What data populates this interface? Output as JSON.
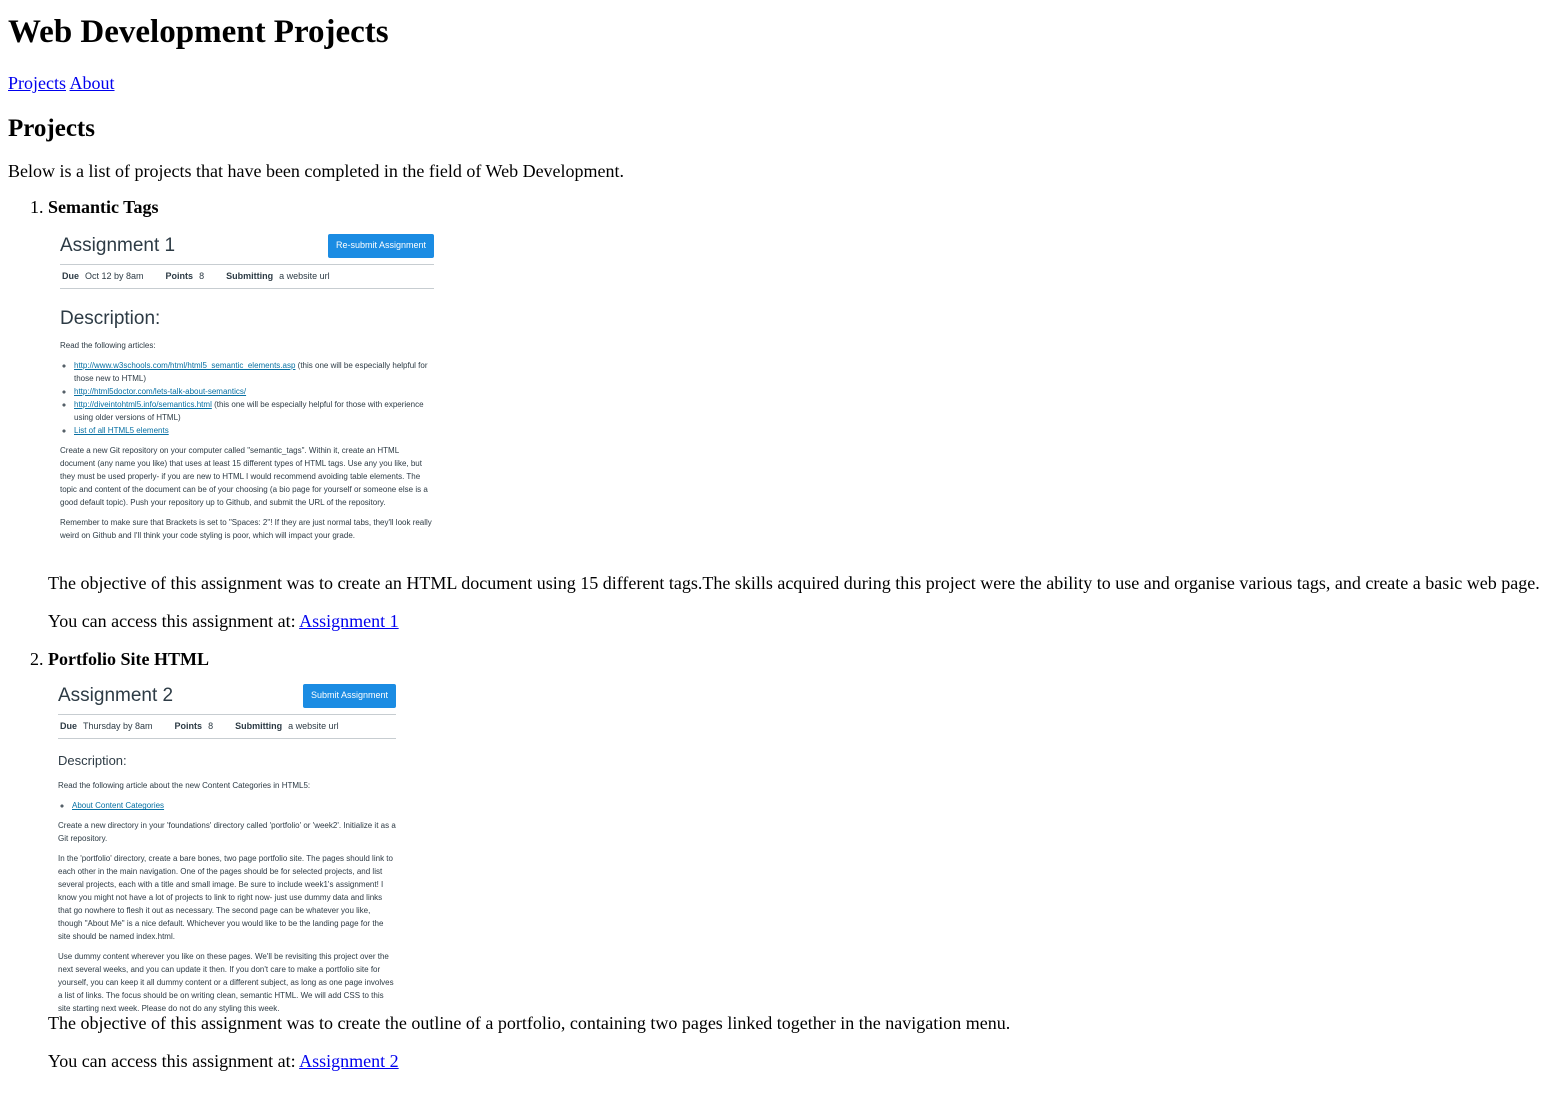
{
  "site": {
    "title": "Web Development Projects",
    "nav": [
      {
        "label": "Projects"
      },
      {
        "label": "About"
      }
    ]
  },
  "main": {
    "heading": "Projects",
    "intro": "Below is a list of projects that have been completed in the field of Web Development.",
    "projects": [
      {
        "title": "Semantic Tags",
        "objective": "The objective of this assignment was to create an HTML document using 15 different tags.The skills acquired during this project were the ability to use and organise various tags, and create a basic web page.",
        "access_prefix": "You can access this assignment at: ",
        "link_label": "Assignment 1",
        "screenshot": {
          "title": "Assignment 1",
          "button": "Re-submit Assignment",
          "due_label": "Due",
          "due": "Oct 12 by 8am",
          "points_label": "Points",
          "points": "8",
          "submitting_label": "Submitting",
          "submitting": "a website url",
          "desc_heading": "Description:",
          "lead": "Read the following articles:",
          "links": [
            {
              "url": "http://www.w3schools.com/html/html5_semantic_elements.asp",
              "note": " (this one will be especially helpful for those new to HTML)"
            },
            {
              "url": "http://html5doctor.com/lets-talk-about-semantics/",
              "note": ""
            },
            {
              "url": "http://diveintohtml5.info/semantics.html",
              "note": " (this one will be especially helpful for those with experience using older versions of HTML)"
            },
            {
              "url": "List of all HTML5 elements",
              "note": ""
            }
          ],
          "para1": "Create a new Git repository on your computer called \"semantic_tags\". Within it, create an HTML document (any name you like) that uses at least 15 different types of HTML tags. Use any you like, but they must be used properly- if you are new to HTML I would recommend avoiding table elements. The topic and content of the document can be of your choosing (a bio page for yourself or someone else is a good default topic). Push your repository up to Github, and submit the URL of the repository.",
          "para2": "Remember to make sure that Brackets is set to \"Spaces: 2\"! If they are just normal tabs, they'll look really weird on Github and I'll think your code styling is poor, which will impact your grade."
        }
      },
      {
        "title": "Portfolio Site HTML",
        "objective": "The objective of this assignment was to create the outline of a portfolio, containing two pages linked together in the navigation menu.",
        "access_prefix": "You can access this assignment at: ",
        "link_label": "Assignment 2",
        "screenshot": {
          "title": "Assignment 2",
          "button": "Submit Assignment",
          "due_label": "Due",
          "due": "Thursday by 8am",
          "points_label": "Points",
          "points": "8",
          "submitting_label": "Submitting",
          "submitting": "a website url",
          "desc_heading": "Description:",
          "lead": "Read the following article about the new Content Categories in HTML5:",
          "link": "About Content Categories",
          "para1": "Create a new directory in your 'foundations' directory called 'portfolio' or 'week2'. Initialize it as a Git repository.",
          "para2": "In the 'portfolio' directory, create a bare bones, two page portfolio site. The pages should link to each other in the main navigation. One of the pages should be for selected projects, and list several projects, each with a title and small image. Be sure to include week1's assignment! I know you might not have a lot of projects to link to right now- just use dummy data and links that go nowhere to flesh it out as necessary. The second page can be whatever you like, though \"About Me\" is a nice default. Whichever you would like to be the landing page for the site should be named index.html.",
          "para3": "Use dummy content wherever you like on these pages. We'll be revisiting this project over the next several weeks, and you can update it then. If you don't care to make a portfolio site for yourself, you can keep it all dummy content or a different subject, as long as one page involves a list of links. The focus should be on writing clean, semantic HTML. We will add CSS to this site starting next week. Please do not do any styling this week."
        }
      }
    ]
  }
}
